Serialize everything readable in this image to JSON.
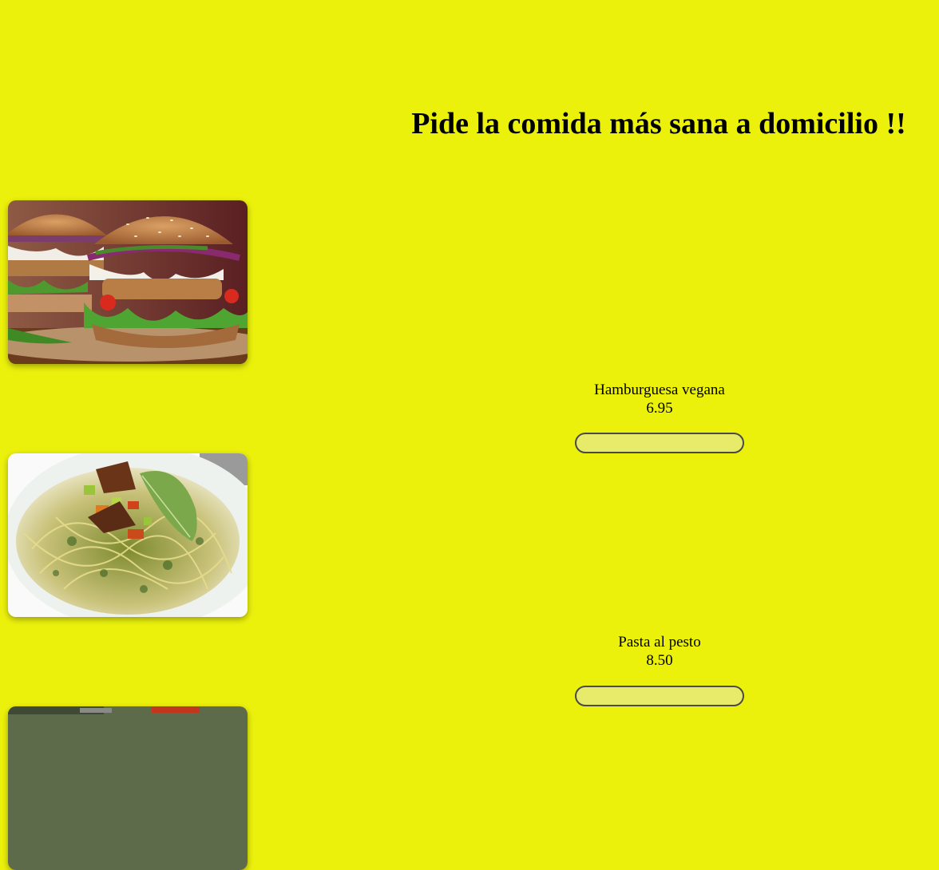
{
  "page": {
    "title": "Pide la comida más sana a domicilio !!",
    "background_color": "#ecf10c"
  },
  "menu": {
    "items": [
      {
        "name": "Hamburguesa vegana",
        "price": "6.95",
        "image": "veggie-burger-photo",
        "button_label": ""
      },
      {
        "name": "Pasta al pesto",
        "price": "8.50",
        "image": "pesto-pasta-photo",
        "button_label": ""
      },
      {
        "image": "salad-photo"
      }
    ]
  }
}
